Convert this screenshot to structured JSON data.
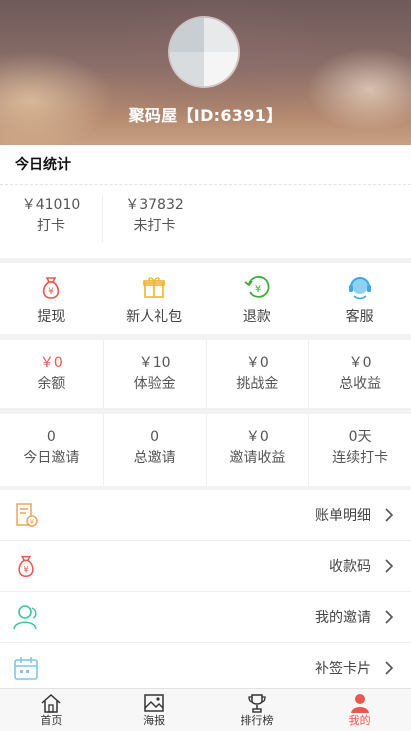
{
  "profile": {
    "username": "聚码屋【ID:6391】"
  },
  "stats": {
    "title": "今日统计",
    "items": [
      {
        "value": "￥41010",
        "label": "打卡"
      },
      {
        "value": "￥37832",
        "label": "未打卡"
      }
    ]
  },
  "actions": [
    {
      "label": "提现",
      "icon": "money-bag-icon"
    },
    {
      "label": "新人礼包",
      "icon": "gift-icon"
    },
    {
      "label": "退款",
      "icon": "refund-icon"
    },
    {
      "label": "客服",
      "icon": "customer-service-icon"
    }
  ],
  "funds": [
    {
      "value": "￥0",
      "label": "余额"
    },
    {
      "value": "￥10",
      "label": "体验金"
    },
    {
      "value": "￥0",
      "label": "挑战金"
    },
    {
      "value": "￥0",
      "label": "总收益"
    }
  ],
  "invites": [
    {
      "value": "0",
      "label": "今日邀请"
    },
    {
      "value": "0",
      "label": "总邀请"
    },
    {
      "value": "￥0",
      "label": "邀请收益"
    },
    {
      "value": "0天",
      "label": "连续打卡"
    }
  ],
  "menu": [
    {
      "label": "账单明细",
      "icon": "bill-icon"
    },
    {
      "label": "收款码",
      "icon": "money-bag-icon"
    },
    {
      "label": "我的邀请",
      "icon": "user-icon"
    },
    {
      "label": "补签卡片",
      "icon": "calendar-icon"
    }
  ],
  "tabs": [
    {
      "label": "首页",
      "icon": "home-icon"
    },
    {
      "label": "海报",
      "icon": "image-icon"
    },
    {
      "label": "排行榜",
      "icon": "trophy-icon"
    },
    {
      "label": "我的",
      "icon": "person-icon"
    }
  ],
  "colors": {
    "accent": "#e8584f",
    "gift": "#f0b429",
    "refund": "#3bb13b",
    "service": "#3fa9e8",
    "invite_icon": "#3cc4a3",
    "bill_icon": "#f0a35c"
  }
}
